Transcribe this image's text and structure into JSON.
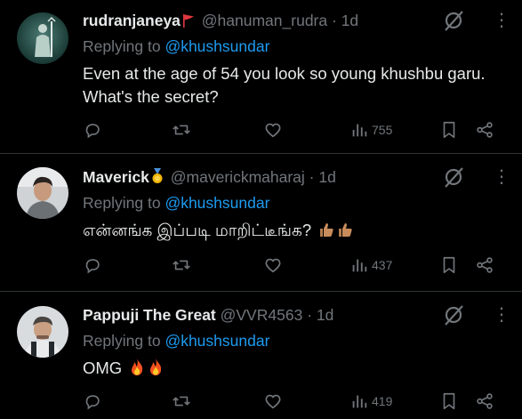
{
  "replies": [
    {
      "name": "rudranjaneya",
      "handle": "@hanuman_rudra",
      "separator": "·",
      "time": "1d",
      "replying_prefix": "Replying to",
      "replying_to": "@khushsundar",
      "text": "Even at the age of 54 you look so young khushbu garu. What's the secret?",
      "views": "755",
      "badge_icon": "red-flag-icon"
    },
    {
      "name": "Maverick",
      "handle": "@maverickmaharaj",
      "separator": "·",
      "time": "1d",
      "replying_prefix": "Replying to",
      "replying_to": "@khushsundar",
      "text": "என்னங்க இப்படி மாறிட்டீங்க?",
      "views": "437",
      "badge_icon": "gold-medal-icon"
    },
    {
      "name": "Pappuji The Great",
      "handle": "@VVR4563",
      "separator": "·",
      "time": "1d",
      "replying_prefix": "Replying to",
      "replying_to": "@khushsundar",
      "text": "OMG",
      "views": "419",
      "badge_icon": ""
    }
  ],
  "colors": {
    "background": "#000000",
    "text": "#e7e9ea",
    "muted": "#71767b",
    "link": "#1d9bf0",
    "divider": "#2f3336"
  }
}
